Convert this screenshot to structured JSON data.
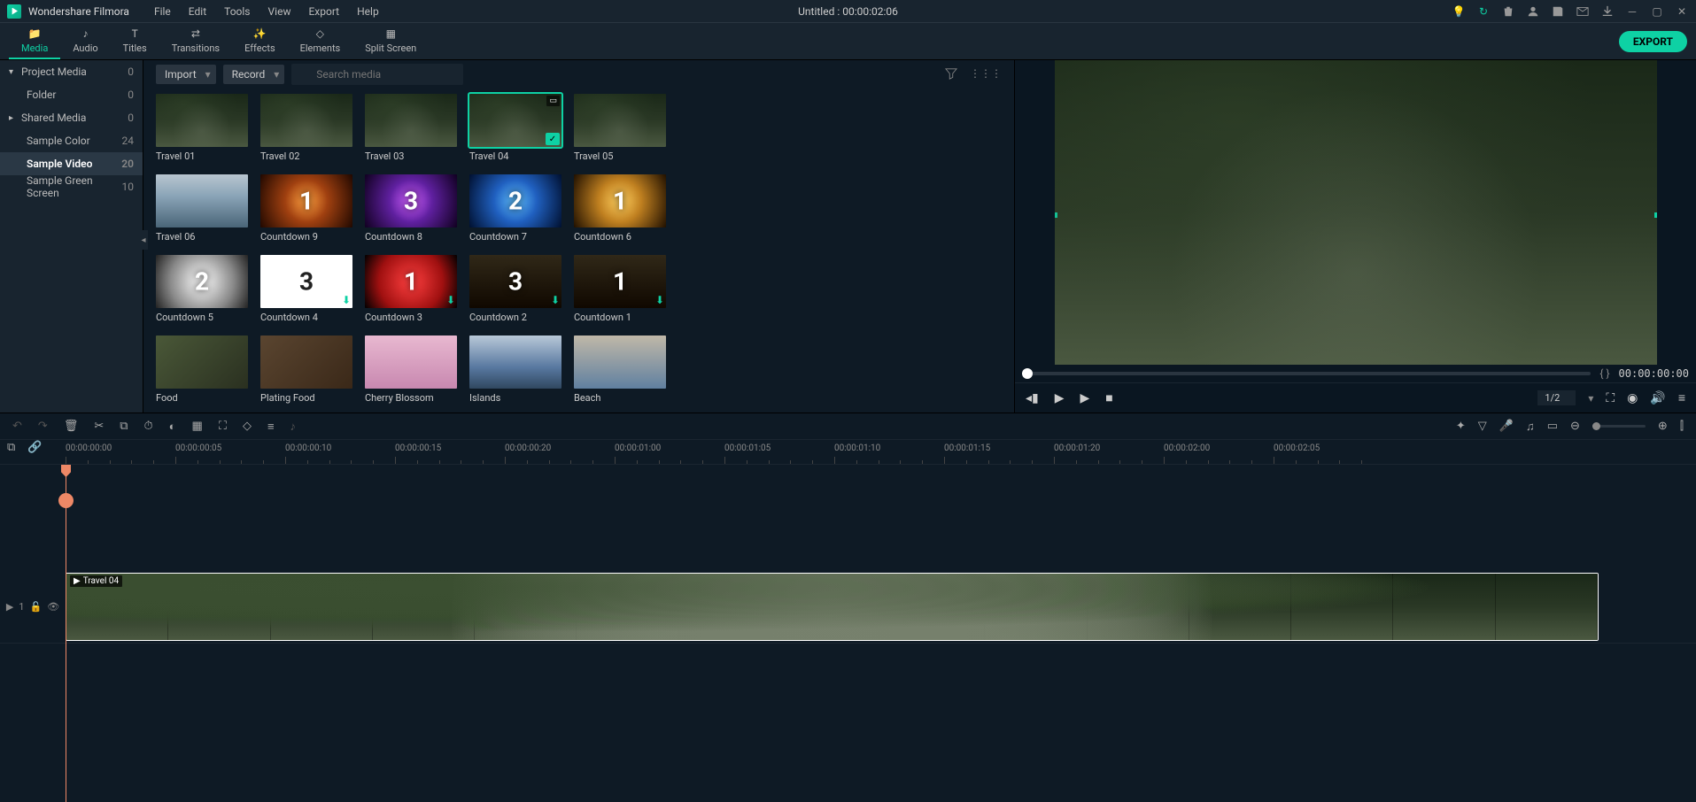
{
  "app": {
    "title": "Wondershare Filmora"
  },
  "menu": [
    "File",
    "Edit",
    "Tools",
    "View",
    "Export",
    "Help"
  ],
  "document": {
    "title": "Untitled : 00:00:02:06"
  },
  "tabs": [
    {
      "label": "Media",
      "active": true
    },
    {
      "label": "Audio"
    },
    {
      "label": "Titles"
    },
    {
      "label": "Transitions"
    },
    {
      "label": "Effects"
    },
    {
      "label": "Elements"
    },
    {
      "label": "Split Screen"
    }
  ],
  "export_label": "EXPORT",
  "sidebar": [
    {
      "label": "Project Media",
      "count": "0",
      "chev": "▾"
    },
    {
      "label": "Folder",
      "count": "0",
      "child": true
    },
    {
      "label": "Shared Media",
      "count": "0",
      "chev": "▸"
    },
    {
      "label": "Sample Color",
      "count": "24",
      "child": true
    },
    {
      "label": "Sample Video",
      "count": "20",
      "child": true,
      "active": true
    },
    {
      "label": "Sample Green Screen",
      "count": "10",
      "child": true
    }
  ],
  "media_toolbar": {
    "import": "Import",
    "record": "Record",
    "search_placeholder": "Search media"
  },
  "thumbs": [
    {
      "label": "Travel 01",
      "bg": "bg-forest"
    },
    {
      "label": "Travel 02",
      "bg": "bg-forest"
    },
    {
      "label": "Travel 03",
      "bg": "bg-forest"
    },
    {
      "label": "Travel 04",
      "bg": "bg-forest",
      "selected": true,
      "vid": true,
      "check": true
    },
    {
      "label": "Travel 05",
      "bg": "bg-forest"
    },
    {
      "label": "Travel 06",
      "bg": "bg-lake"
    },
    {
      "label": "Countdown 9",
      "bg": "bg-orange",
      "num": "1"
    },
    {
      "label": "Countdown 8",
      "bg": "bg-purple",
      "num": "3"
    },
    {
      "label": "Countdown 7",
      "bg": "bg-blue",
      "num": "2"
    },
    {
      "label": "Countdown 6",
      "bg": "bg-gold",
      "num": "1"
    },
    {
      "label": "Countdown 5",
      "bg": "bg-gray",
      "num": "2"
    },
    {
      "label": "Countdown 4",
      "bg": "bg-white",
      "num": "3",
      "numdark": true,
      "dl": true
    },
    {
      "label": "Countdown 3",
      "bg": "bg-red",
      "num": "1",
      "dl": true
    },
    {
      "label": "Countdown 2",
      "bg": "bg-dark",
      "num": "3",
      "dl": true
    },
    {
      "label": "Countdown 1",
      "bg": "bg-dark",
      "num": "1",
      "dl": true
    },
    {
      "label": "Food",
      "bg": "bg-food"
    },
    {
      "label": "Plating Food",
      "bg": "bg-food2"
    },
    {
      "label": "Cherry Blossom",
      "bg": "bg-pink"
    },
    {
      "label": "Islands",
      "bg": "bg-sea"
    },
    {
      "label": "Beach",
      "bg": "bg-beach"
    }
  ],
  "preview": {
    "bracket": "{   }",
    "timecode": "00:00:00:00",
    "scale": "1/2"
  },
  "ruler": [
    "00:00:00:00",
    "00:00:00:05",
    "00:00:00:10",
    "00:00:00:15",
    "00:00:00:20",
    "00:00:01:00",
    "00:00:01:05",
    "00:00:01:10",
    "00:00:01:15",
    "00:00:01:20",
    "00:00:02:00",
    "00:00:02:05"
  ],
  "clip": {
    "label": "Travel 04"
  },
  "track_head": {
    "label": "1"
  }
}
